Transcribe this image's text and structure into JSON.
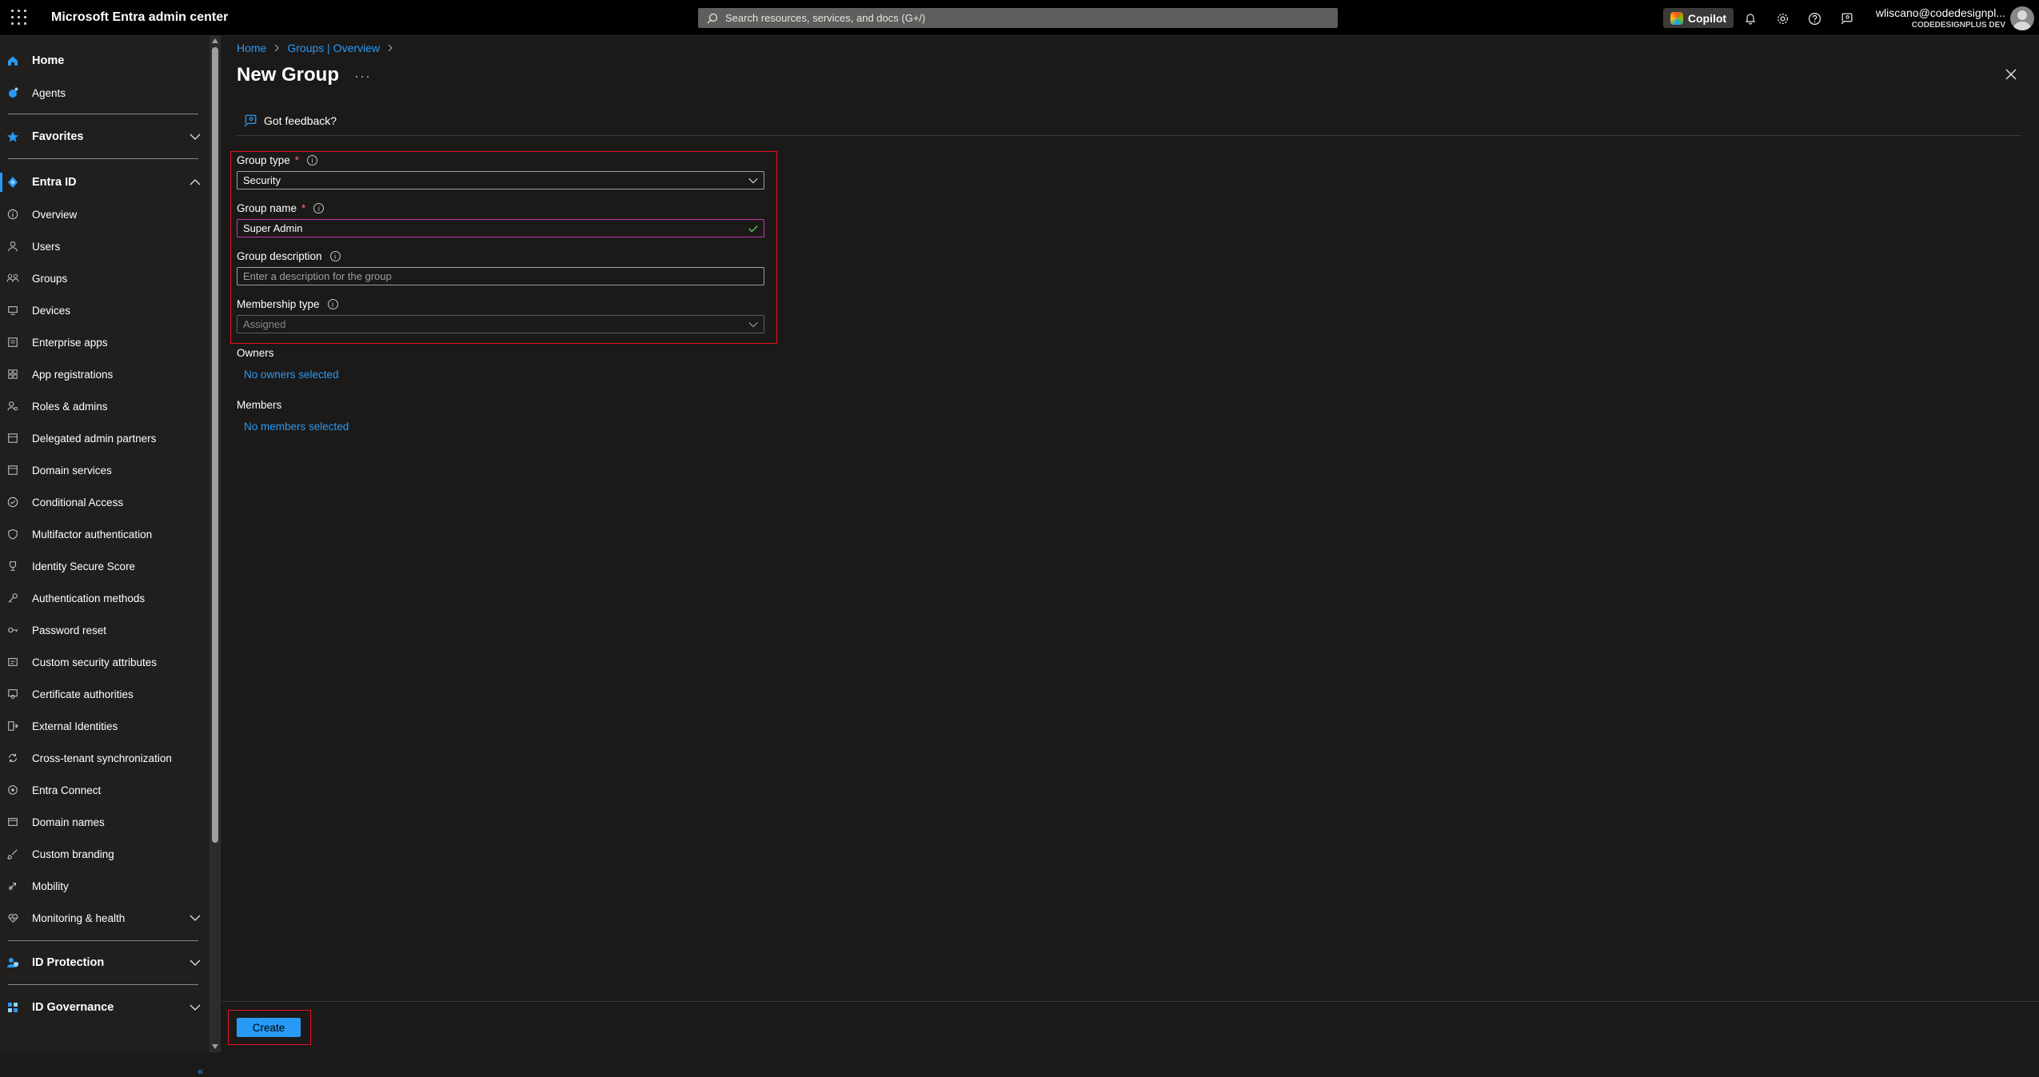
{
  "app": {
    "title": "Microsoft Entra admin center",
    "search_placeholder": "Search resources, services, and docs (G+/)",
    "copilot_label": "Copilot",
    "user_name": "wliscano@codedesignpl...",
    "user_tenant": "CODEDESIGNPLUS DEV"
  },
  "sidebar": {
    "home": "Home",
    "agents": "Agents",
    "favorites": "Favorites",
    "entra_id": "Entra ID",
    "items": [
      "Overview",
      "Users",
      "Groups",
      "Devices",
      "Enterprise apps",
      "App registrations",
      "Roles & admins",
      "Delegated admin partners",
      "Domain services",
      "Conditional Access",
      "Multifactor authentication",
      "Identity Secure Score",
      "Authentication methods",
      "Password reset",
      "Custom security attributes",
      "Certificate authorities",
      "External Identities",
      "Cross-tenant synchronization",
      "Entra Connect",
      "Domain names",
      "Custom branding",
      "Mobility",
      "Monitoring & health"
    ],
    "id_protection": "ID Protection",
    "id_governance": "ID Governance",
    "collapse": "«"
  },
  "breadcrumb": {
    "home": "Home",
    "groups": "Groups | Overview"
  },
  "page": {
    "title": "New Group",
    "more": "···",
    "feedback": "Got feedback?"
  },
  "form": {
    "group_type_label": "Group type",
    "group_type_value": "Security",
    "group_name_label": "Group name",
    "group_name_value": "Super Admin",
    "group_description_label": "Group description",
    "group_description_placeholder": "Enter a description for the group",
    "membership_type_label": "Membership type",
    "membership_type_value": "Assigned",
    "required_mark": "*",
    "info_mark": "i",
    "owners_label": "Owners",
    "owners_link": "No owners selected",
    "members_label": "Members",
    "members_link": "No members selected"
  },
  "footer": {
    "create_label": "Create"
  },
  "colors": {
    "accent": "#2899f5",
    "highlight_box": "#e81123",
    "focus_border": "#c239b3"
  }
}
